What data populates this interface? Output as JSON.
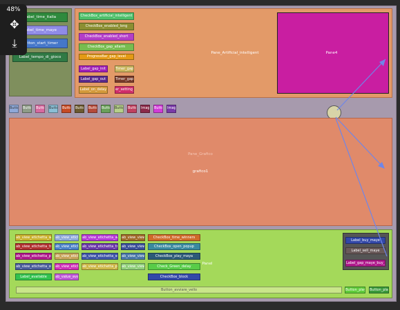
{
  "zoom": {
    "level": "48%",
    "fit_icon": "move-arrows-icon",
    "export_icon": "download-tray-icon"
  },
  "colors": {
    "canvas": "#2b2b2b",
    "scene": "#a79aad",
    "panel_green": "#7f8f5d",
    "panel_orange": "#e39a68",
    "pane4": "#c91ea1",
    "bottom_panel": "#a4d95a",
    "accent_lines": "#6f86e8"
  },
  "top_left": {
    "label_time_italia": "Label_time_italia",
    "label_time_maya": "Label_time_maye",
    "button_start_timer": "Button_start_timer",
    "label_tempo_di_gioco": "Label_tempo_di_gioco"
  },
  "top_mid": {
    "check_artificial": "CheckBox_artificial_intelligent",
    "check_enabled_long": "CheckBox_enabled_long",
    "check_enabled_short": "CheckBox_enabled_short",
    "check_gap_allarm": "CheckBox_gap_allarm",
    "progress_gap_level": "ProgressBar_gap_level",
    "label_gap_init": "Label_gap_init",
    "label_gap_out": "Label_gap_out",
    "timer_gap1": "Timer_gap_",
    "timer_gap2": "Timer_gap_",
    "label_on_delay": "Label_on_delay",
    "setting_btn": "er_setting_"
  },
  "pane_artificial": "Pane_Artificial_intelligent",
  "pane4": "Pane4",
  "button_row": [
    "Butto",
    "Butto",
    "Butto",
    "Butto",
    "Button",
    "Button",
    "Button",
    "Button",
    "Button",
    "Button",
    "Image",
    "Button",
    "Image"
  ],
  "graph": {
    "label": "grafico1",
    "hint": "Pane_Grafico"
  },
  "bottom": {
    "col1": [
      "ab_view_etichetta_win",
      "ab_view_etichetta_tra",
      "ab_view_etichetta_pun",
      "ab_view_etichetta_succ",
      "Label_available"
    ],
    "col2": [
      "ab_view_etichet",
      "ab_view_etich",
      "ab_view_etichet",
      "ab_view_etich",
      "ab_value_avail"
    ],
    "col3": [
      "ab_view_etichetta_win",
      "ab_view_etichetta_tra",
      "ab_view_etichetta_sos",
      "ab_view_etichetta_pla"
    ],
    "col4": [
      "ab_view_view_w",
      "ab_view_view_tr",
      "ab_view_view_te",
      "ab_view_view_s"
    ],
    "col5": [
      "CheckBox_time_winners",
      "CheckBox_open_popup",
      "CheckBox_play_maya",
      "Check_Green_delay",
      "CheckBox_block"
    ],
    "pane_label": "Panel",
    "right": [
      "Label_buy_maye",
      "Label_sell_maye",
      "Label_gap_maye_buy_m"
    ],
    "footer": "Button_avviare_vello",
    "footer_btn1": "Button_play_it",
    "footer_btn2": "Button_play_it"
  }
}
